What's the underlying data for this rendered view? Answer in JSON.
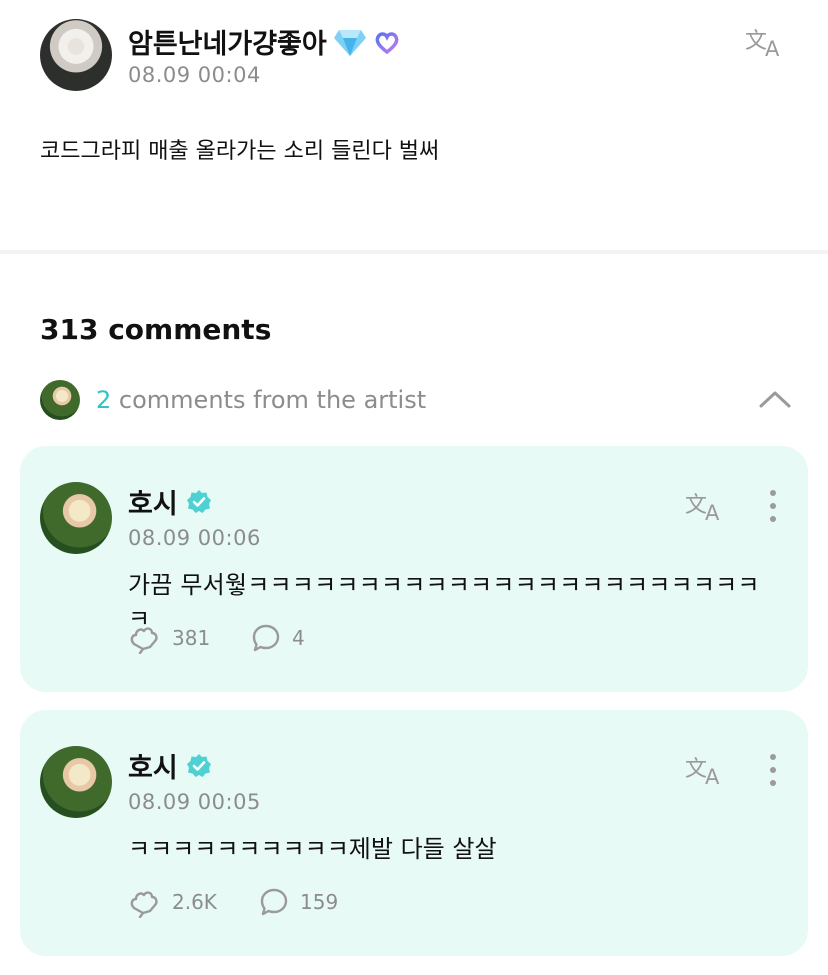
{
  "post": {
    "author": "암튼난네가걍좋아",
    "author_badge_icons": [
      "diamond-icon",
      "membership-heart-icon"
    ],
    "time": "08.09 00:04",
    "text": "코드그라피 매출 올라가는 소리 들린다 벌써"
  },
  "comments_section": {
    "count_label": "313 comments",
    "artist_count": "2",
    "artist_label": "comments from the artist"
  },
  "artist_comments": [
    {
      "name": "호시",
      "time": "08.09 00:06",
      "text": "가끔 무서웧ㅋㅋㅋㅋㅋㅋㅋㅋㅋㅋㅋㅋㅋㅋㅋㅋㅋㅋㅋㅋㅋㅋㅋㅋ",
      "likes": "381",
      "replies": "4"
    },
    {
      "name": "호시",
      "time": "08.09 00:05",
      "text": "ㅋㅋㅋㅋㅋㅋㅋㅋㅋㅋ제발 다들 살살",
      "likes": "2.6K",
      "replies": "159"
    }
  ],
  "colors": {
    "accent": "#2ec4c6",
    "card_bg": "#e8faf5",
    "muted": "#8c8c8c"
  }
}
